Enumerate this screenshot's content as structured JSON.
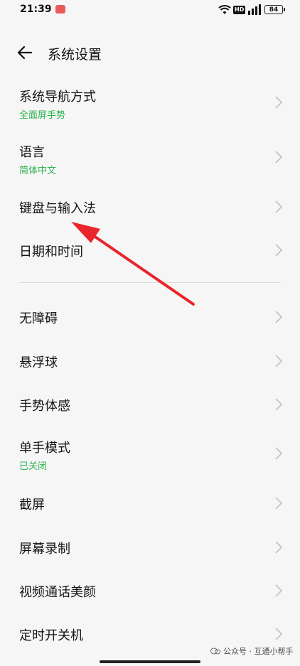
{
  "status_bar": {
    "time": "21:39",
    "network": "HD",
    "battery": "84"
  },
  "header": {
    "title": "系统设置"
  },
  "items": [
    {
      "title": "系统导航方式",
      "subtitle": "全面屏手势"
    },
    {
      "title": "语言",
      "subtitle": "简体中文"
    },
    {
      "title": "键盘与输入法"
    },
    {
      "title": "日期和时间"
    },
    {
      "title": "无障碍"
    },
    {
      "title": "悬浮球"
    },
    {
      "title": "手势体感"
    },
    {
      "title": "单手模式",
      "subtitle": "已关闭"
    },
    {
      "title": "截屏"
    },
    {
      "title": "屏幕录制"
    },
    {
      "title": "视频通话美颜"
    },
    {
      "title": "定时开关机"
    }
  ],
  "watermark": {
    "text": "公众号 · 互通小帮手"
  },
  "colors": {
    "accent_green": "#2bb24c",
    "annotation_arrow": "#e8262b",
    "background": "#f6f6f6"
  }
}
